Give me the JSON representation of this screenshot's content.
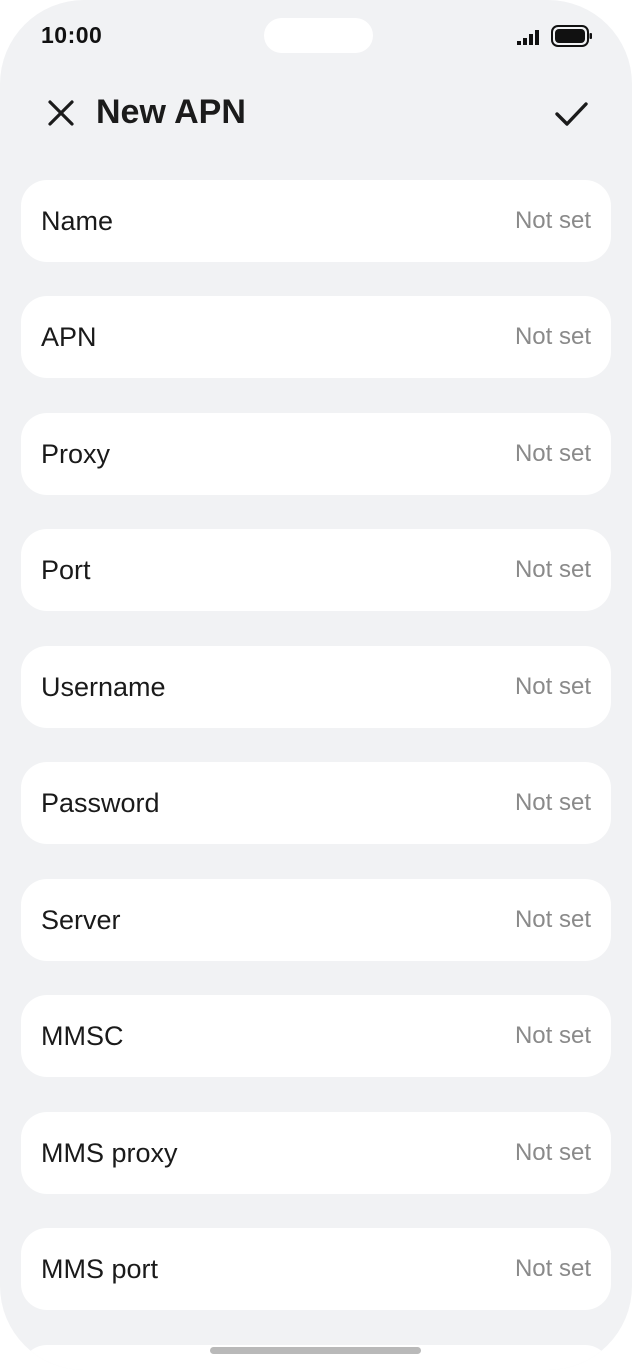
{
  "status_bar": {
    "time": "10:00"
  },
  "header": {
    "title": "New APN",
    "close_icon": "close-icon",
    "confirm_icon": "checkmark-icon"
  },
  "fields": [
    {
      "label": "Name",
      "value": "Not set"
    },
    {
      "label": "APN",
      "value": "Not set"
    },
    {
      "label": "Proxy",
      "value": "Not set"
    },
    {
      "label": "Port",
      "value": "Not set"
    },
    {
      "label": "Username",
      "value": "Not set"
    },
    {
      "label": "Password",
      "value": "Not set"
    },
    {
      "label": "Server",
      "value": "Not set"
    },
    {
      "label": "MMSC",
      "value": "Not set"
    },
    {
      "label": "MMS proxy",
      "value": "Not set"
    },
    {
      "label": "MMS port",
      "value": "Not set"
    }
  ],
  "colors": {
    "background": "#f1f2f4",
    "card": "#ffffff",
    "primary_text": "#1a1a1a",
    "secondary_text": "#8a8a8a"
  }
}
